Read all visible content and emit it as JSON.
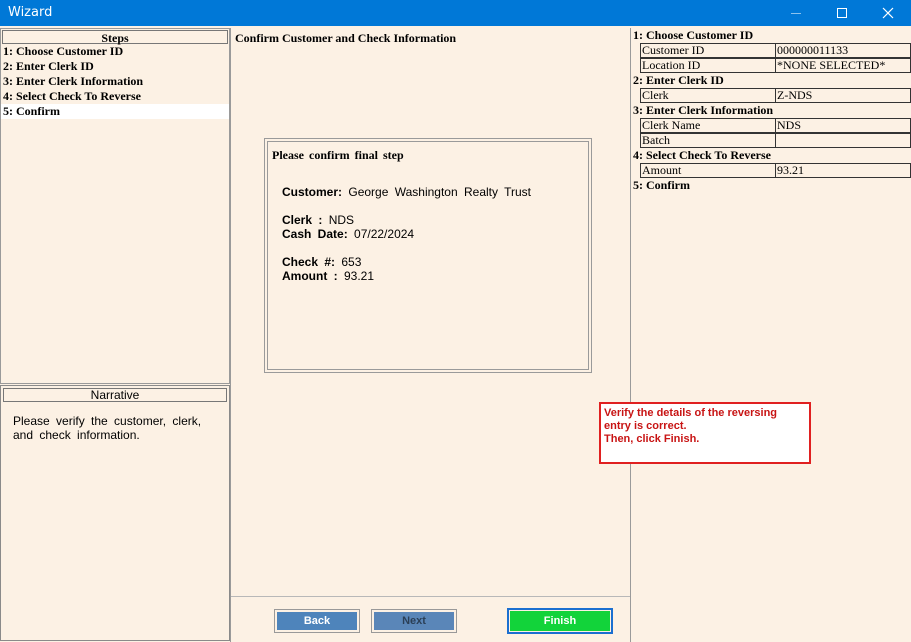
{
  "window": {
    "title": "Wizard"
  },
  "steps": {
    "header": "Steps",
    "items": [
      "1: Choose Customer ID",
      "2: Enter Clerk ID",
      "3: Enter Clerk Information",
      "4: Select Check To Reverse",
      "5: Confirm"
    ]
  },
  "narrative": {
    "header": "Narrative",
    "text": "Please verify the customer, clerk, and check information."
  },
  "main": {
    "title": "Confirm Customer and Check Information",
    "confirm_heading": "Please confirm final step",
    "customer_label": "Customer:",
    "customer_value": "George Washington Realty Trust",
    "clerk_label": "Clerk :",
    "clerk_value": "NDS",
    "cash_date_label": "Cash Date:",
    "cash_date_value": "07/22/2024",
    "check_label": "Check #:",
    "check_value": "653",
    "amount_label": "Amount :",
    "amount_value": "93.21"
  },
  "buttons": {
    "back": "Back",
    "next": "Next",
    "finish": "Finish"
  },
  "tip": {
    "line1": "Verify the details of the reversing",
    "line2": "entry is correct.",
    "line3": "Then, click Finish."
  },
  "summary": {
    "sections": [
      {
        "title": "1: Choose Customer ID",
        "rows": [
          {
            "key": "Customer ID",
            "value": "000000011133"
          },
          {
            "key": "Location ID",
            "value": "*NONE SELECTED*"
          }
        ]
      },
      {
        "title": "2: Enter Clerk ID",
        "rows": [
          {
            "key": "Clerk",
            "value": "Z-NDS"
          }
        ]
      },
      {
        "title": "3: Enter Clerk Information",
        "rows": [
          {
            "key": "Clerk Name",
            "value": "NDS"
          },
          {
            "key": "Batch",
            "value": ""
          }
        ]
      },
      {
        "title": "4: Select Check To Reverse",
        "rows": [
          {
            "key": "Amount",
            "value": "93.21"
          }
        ]
      },
      {
        "title": "5: Confirm",
        "rows": []
      }
    ]
  }
}
